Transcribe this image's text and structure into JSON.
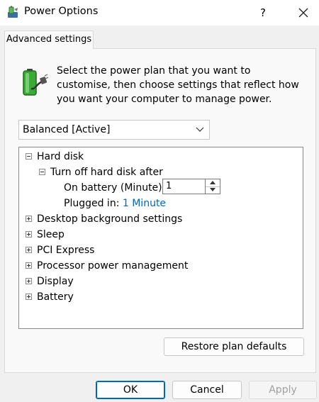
{
  "window": {
    "title": "Power Options",
    "icon": "power-options-icon",
    "help_label": "?",
    "close_label": "✕"
  },
  "tab": {
    "label": "Advanced settings"
  },
  "intro": {
    "icon": "battery-plug-icon",
    "text": "Select the power plan that you want to customise, then choose settings that reflect how you want your computer to manage power."
  },
  "plan": {
    "selected": "Balanced [Active]"
  },
  "tree": {
    "hard_disk": "Hard disk",
    "turn_off_after": "Turn off hard disk after",
    "on_battery_label": "On battery (Minute):",
    "on_battery_value": "1",
    "plugged_in_label": "Plugged in:",
    "plugged_in_value": "1 Minute",
    "desktop_background": "Desktop background settings",
    "sleep": "Sleep",
    "pci_express": "PCI Express",
    "processor": "Processor power management",
    "display": "Display",
    "battery": "Battery"
  },
  "buttons": {
    "restore": "Restore plan defaults",
    "ok": "OK",
    "cancel": "Cancel",
    "apply": "Apply"
  },
  "colors": {
    "link": "#0066cc",
    "ok_border": "#0067c0",
    "battery_green": "#3aa935"
  }
}
